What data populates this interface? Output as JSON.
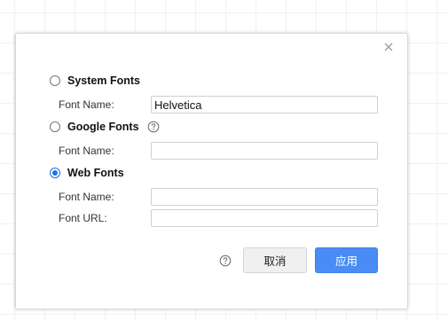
{
  "dialog": {
    "close_symbol": "×",
    "accent_color": "#4a8cf5",
    "options": {
      "system": {
        "label": "System Fonts",
        "selected": false,
        "font_name_label": "Font Name:",
        "font_name_value": "Helvetica"
      },
      "google": {
        "label": "Google Fonts",
        "selected": false,
        "help_icon": "question-circle-icon",
        "font_name_label": "Font Name:",
        "font_name_value": ""
      },
      "web": {
        "label": "Web Fonts",
        "selected": true,
        "font_name_label": "Font Name:",
        "font_name_value": "",
        "font_url_label": "Font URL:",
        "font_url_value": ""
      }
    },
    "footer": {
      "help_icon": "question-circle-icon",
      "cancel_label": "取消",
      "apply_label": "应用"
    }
  }
}
